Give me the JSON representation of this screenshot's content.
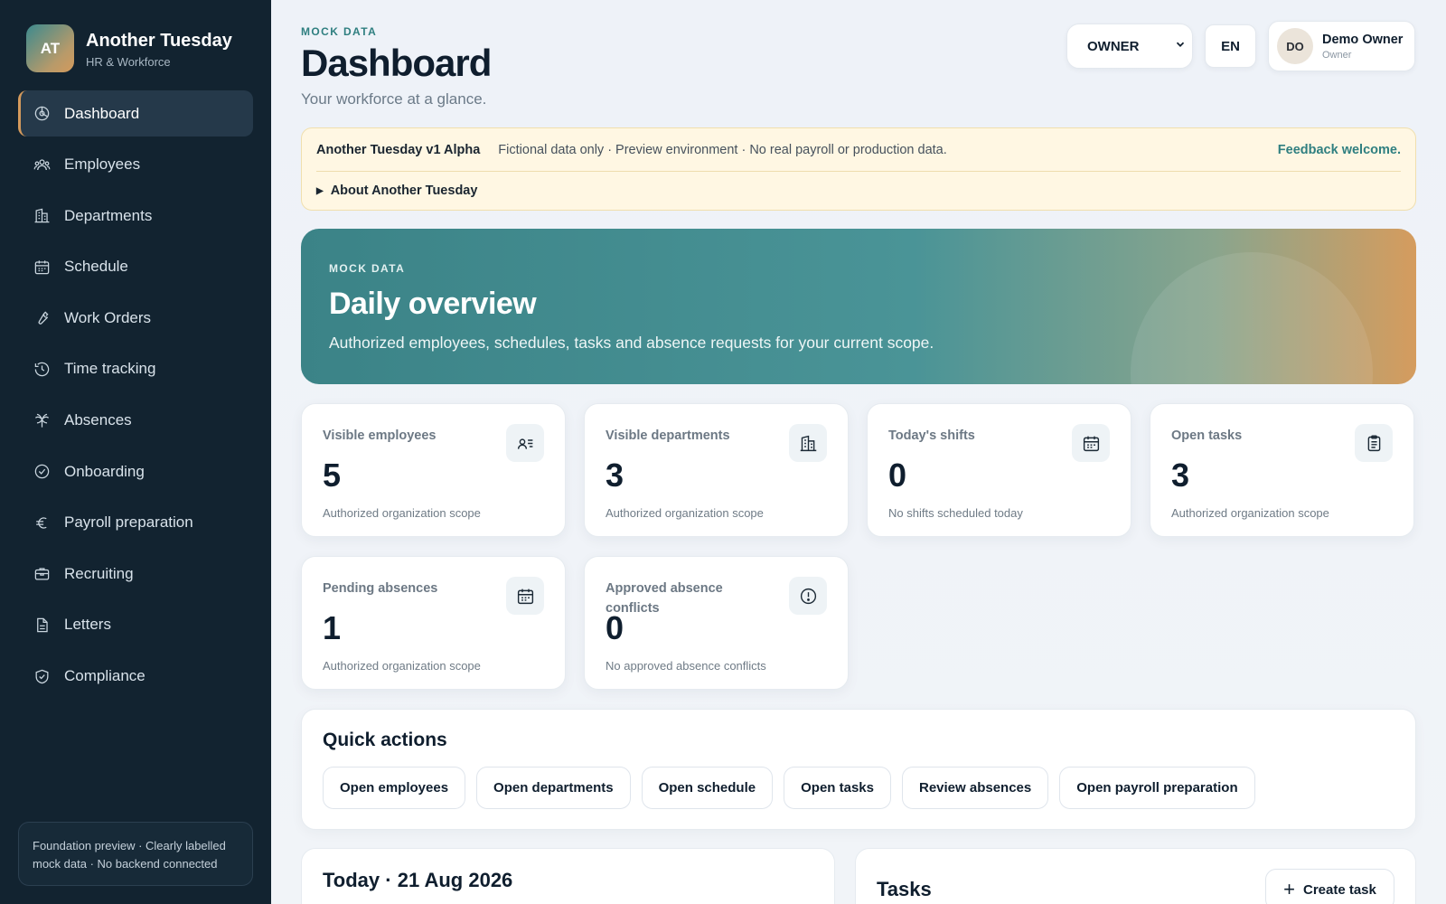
{
  "brand": {
    "initials": "AT",
    "name": "Another Tuesday",
    "subtitle": "HR & Workforce"
  },
  "sidebar": {
    "items": [
      {
        "label": "Dashboard",
        "icon": "dashboard-icon",
        "active": true
      },
      {
        "label": "Employees",
        "icon": "employees-icon"
      },
      {
        "label": "Departments",
        "icon": "departments-icon"
      },
      {
        "label": "Schedule",
        "icon": "schedule-icon"
      },
      {
        "label": "Work Orders",
        "icon": "wrench-icon"
      },
      {
        "label": "Time tracking",
        "icon": "history-icon"
      },
      {
        "label": "Absences",
        "icon": "palm-tree-icon"
      },
      {
        "label": "Onboarding",
        "icon": "check-circle-icon"
      },
      {
        "label": "Payroll preparation",
        "icon": "euro-icon"
      },
      {
        "label": "Recruiting",
        "icon": "briefcase-icon"
      },
      {
        "label": "Letters",
        "icon": "document-icon"
      },
      {
        "label": "Compliance",
        "icon": "shield-check-icon"
      }
    ],
    "footer_note": "Foundation preview · Clearly labelled mock data · No backend connected"
  },
  "header": {
    "eyebrow": "MOCK DATA",
    "title": "Dashboard",
    "subtitle": "Your workforce at a glance.",
    "role_select": {
      "value": "OWNER"
    },
    "language": "EN",
    "user": {
      "initials": "DO",
      "name": "Demo Owner",
      "role": "Owner"
    }
  },
  "alpha_banner": {
    "title": "Another Tuesday v1 Alpha",
    "note": "Fictional data only · Preview environment · No real payroll or production data.",
    "link": "Feedback welcome.",
    "about": "About Another Tuesday"
  },
  "hero": {
    "eyebrow": "MOCK DATA",
    "title": "Daily overview",
    "subtitle": "Authorized employees, schedules, tasks and absence requests for your current scope."
  },
  "stats": [
    {
      "label": "Visible employees",
      "value": "5",
      "note": "Authorized organization scope",
      "icon": "id-card-icon"
    },
    {
      "label": "Visible departments",
      "value": "3",
      "note": "Authorized organization scope",
      "icon": "building-icon"
    },
    {
      "label": "Today's shifts",
      "value": "0",
      "note": "No shifts scheduled today",
      "icon": "calendar-icon"
    },
    {
      "label": "Open tasks",
      "value": "3",
      "note": "Authorized organization scope",
      "icon": "clipboard-icon"
    },
    {
      "label": "Pending absences",
      "value": "1",
      "note": "Authorized organization scope",
      "icon": "calendar-icon"
    },
    {
      "label": "Approved absence conflicts",
      "value": "0",
      "note": "No approved absence conflicts",
      "icon": "alert-circle-icon"
    }
  ],
  "quick_actions": {
    "title": "Quick actions",
    "buttons": [
      "Open employees",
      "Open departments",
      "Open schedule",
      "Open tasks",
      "Review absences",
      "Open payroll preparation"
    ]
  },
  "today_panel": {
    "title": "Today · 21 Aug 2026"
  },
  "tasks_panel": {
    "title": "Tasks",
    "create_label": "Create task"
  }
}
